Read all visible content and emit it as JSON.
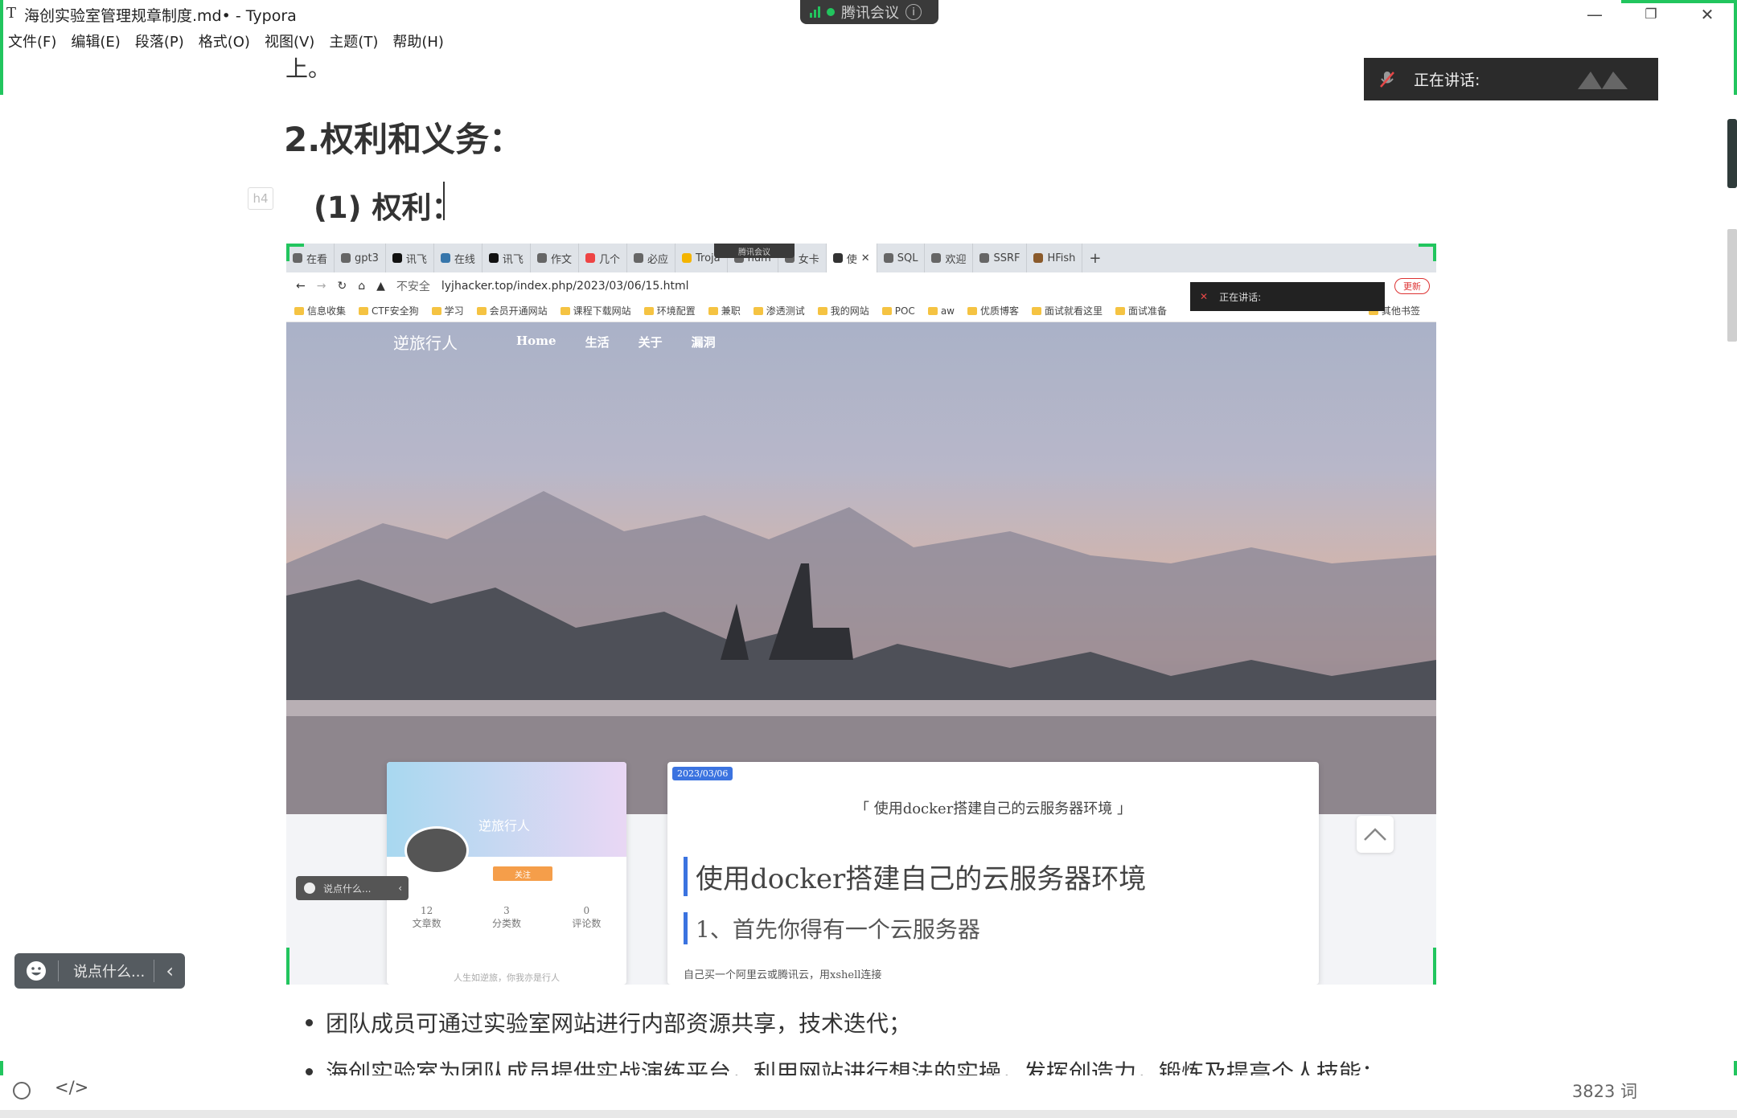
{
  "window": {
    "title": "海创实验室管理规章制度.md• - Typora",
    "minimize": "—",
    "restore": "❐",
    "close": "✕"
  },
  "menu": [
    "文件(F)",
    "编辑(E)",
    "段落(P)",
    "格式(O)",
    "视图(V)",
    "主题(T)",
    "帮助(H)"
  ],
  "meeting": {
    "app": "腾讯会议",
    "speaking_label": "正在讲话:"
  },
  "document": {
    "fragment": "上。",
    "heading2": "2.权利和义务：",
    "heading_level_tag": "h4",
    "heading4": "(1) 权利：",
    "bullets": [
      "团队成员可通过实验室网站进行内部资源共享，技术迭代；",
      "海创实验室为团队成员提供实战演练平台，利用网站进行想法的实操，发挥创造力，锻炼及提高个人技能；"
    ]
  },
  "embedded_browser": {
    "tabs": [
      "在看",
      "gpt3",
      "讯飞",
      "在线",
      "讯飞",
      "作文",
      "几个",
      "必应",
      "Troja",
      "hum",
      "女卡",
      "使",
      "SQL",
      "欢迎",
      "SSRF",
      "HFish"
    ],
    "url_warning": "不安全",
    "url": "lyjhacker.top/index.php/2023/03/06/15.html",
    "update_label": "更新",
    "bookmarks": [
      "信息收集",
      "CTF安全狗",
      "学习",
      "会员开通网站",
      "课程下载网站",
      "环境配置",
      "兼职",
      "渗透测试",
      "我的网站",
      "POC",
      "aw",
      "优质博客",
      "面试就看这里",
      "面试准备",
      "其他书签"
    ],
    "site": {
      "name": "逆旅行人",
      "nav": [
        "Home",
        "生活",
        "关于",
        "漏洞"
      ],
      "profile_name": "逆旅行人",
      "follow": "关注",
      "stats": [
        {
          "num": "12",
          "label": "文章数"
        },
        {
          "num": "3",
          "label": "分类数"
        },
        {
          "num": "0",
          "label": "评论数"
        }
      ],
      "motto": "人生如逆旅，你我亦是行人",
      "date": "2023/03/06",
      "post_title_small": "「 使用docker搭建自己的云服务器环境 」",
      "post_h1": "使用docker搭建自己的云服务器环境",
      "post_h2": "1、首先你得有一个云服务器",
      "post_p": "自己买一个阿里云或腾讯云，用xshell连接"
    },
    "say_placeholder": "说点什么..."
  },
  "say_box": {
    "placeholder": "说点什么..."
  },
  "status": {
    "word_count": "3823 词"
  },
  "colors": {
    "meeting_green": "#22c55e",
    "chip_blue": "#3b73e0",
    "follow_orange": "#f59e4a"
  }
}
